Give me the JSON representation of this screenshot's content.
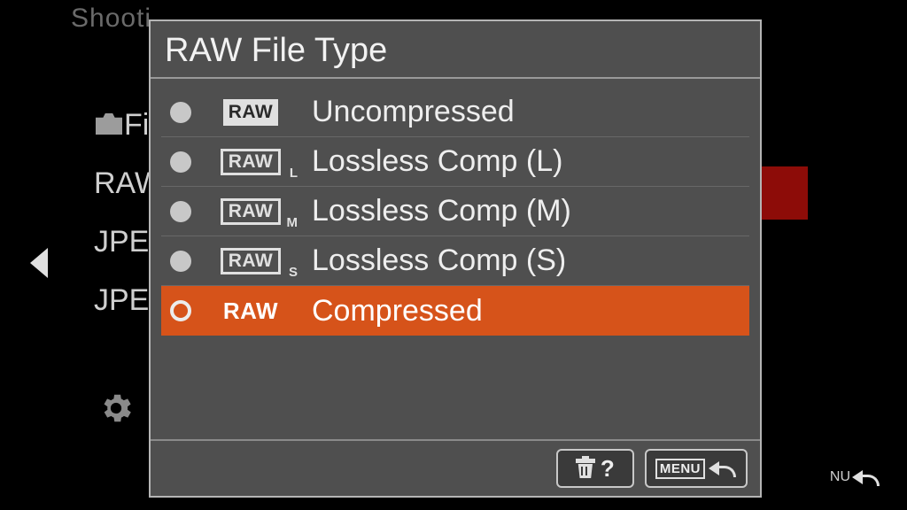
{
  "dialog": {
    "title": "RAW File Type",
    "options": [
      {
        "badge_text": "RAW",
        "badge_style": "solid",
        "sub": "",
        "label": "Uncompressed",
        "selected": false
      },
      {
        "badge_text": "RAW",
        "badge_style": "outline",
        "sub": "L",
        "label": "Lossless Comp (L)",
        "selected": false
      },
      {
        "badge_text": "RAW",
        "badge_style": "outline",
        "sub": "M",
        "label": "Lossless Comp (M)",
        "selected": false
      },
      {
        "badge_text": "RAW",
        "badge_style": "outline",
        "sub": "S",
        "label": "Lossless Comp (S)",
        "selected": false
      },
      {
        "badge_text": "RAW",
        "badge_style": "plain",
        "sub": "",
        "label": "Compressed",
        "selected": true
      }
    ],
    "footer": {
      "help_symbol": "?",
      "menu_label": "MENU"
    }
  },
  "background": {
    "top_text": "Shooti",
    "item1": "Fi",
    "item2": "RAW",
    "item3": "JPE",
    "item4": "JPE",
    "bottom_menu": "NU"
  }
}
